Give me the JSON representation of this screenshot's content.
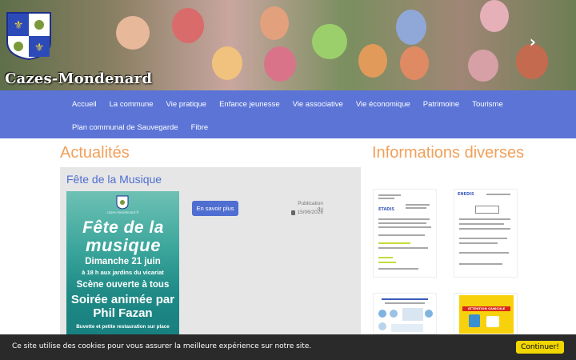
{
  "header": {
    "site_name": "Cazes-Mondenard",
    "next_icon": "chevron-right-icon"
  },
  "nav": {
    "row1": [
      "Accueil",
      "La commune",
      "Vie pratique",
      "Enfance jeunesse",
      "Vie associative",
      "Vie économique",
      "Patrimoine",
      "Tourisme"
    ],
    "row2": [
      "Plan communal de Sauvegarde",
      "Fibre"
    ]
  },
  "news": {
    "section_title": "Actualités",
    "article": {
      "title": "Fête de la Musique",
      "read_more": "En savoir plus",
      "pub_label": "Publication du",
      "pub_date": "15/06/2026",
      "poster": {
        "site": "cazes-mondenard.fr",
        "line1": "Fête de la",
        "line2": "musique",
        "date": "Dimanche 21 juin",
        "place": "à 18 h aux jardins du vicariat",
        "scene": "Scène ouverte à tous",
        "soiree": "Soirée animée par Phil Fazan",
        "buvette": "Buvette et petite restauration sur place"
      }
    }
  },
  "info": {
    "section_title": "Informations diverses",
    "thumbnails": [
      {
        "label": "ETADIS"
      },
      {
        "label": "ENEDIS"
      },
      {
        "label": ""
      },
      {
        "label": "ATTENTION CANICULE"
      }
    ]
  },
  "cookie": {
    "text": "Ce site utilise des cookies pour vous assurer la meilleure expérience sur notre site.",
    "button": "Continuer!"
  },
  "colors": {
    "nav": "#5b74d6",
    "accent_orange": "#f0a05a",
    "link_blue": "#4e6ed0",
    "cookie_bg": "#2a2a2a",
    "cookie_btn": "#f1d600"
  }
}
